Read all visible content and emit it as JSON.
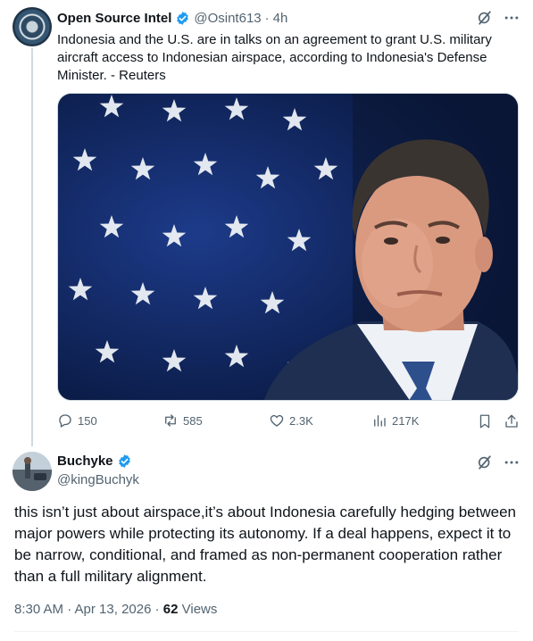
{
  "parent_tweet": {
    "author_name": "Open Source Intel",
    "handle": "@Osint613",
    "separator": "·",
    "time": "4h",
    "text": "Indonesia and the U.S. are in talks on an agreement to grant U.S. military aircraft access to Indonesian airspace, according to Indonesia's Defense Minister. - Reuters",
    "metrics": {
      "replies": "150",
      "reposts": "585",
      "likes": "2.3K",
      "views": "217K"
    }
  },
  "reply_tweet": {
    "author_name": "Buchyke",
    "handle": "@kingBuchyk",
    "text": "this isn’t just about airspace,it’s about Indonesia carefully hedging between major powers while protecting its autonomy. If a deal happens, expect it to be narrow, conditional, and framed as non-permanent cooperation rather than a full military alignment.",
    "timestamp": "8:30 AM · Apr 13, 2026",
    "meta_separator": " · ",
    "views_count": "62",
    "views_label": " Views"
  },
  "icons": {
    "verified": "verified-badge-icon",
    "grok": "grok-icon",
    "more": "more-icon",
    "reply": "reply-icon",
    "repost": "repost-icon",
    "like": "like-icon",
    "views": "views-icon",
    "bookmark": "bookmark-icon",
    "share": "share-icon"
  },
  "colors": {
    "text_primary": "#0f1419",
    "text_secondary": "#536471",
    "verified_blue": "#1d9bf0",
    "border": "#cfd9de"
  }
}
